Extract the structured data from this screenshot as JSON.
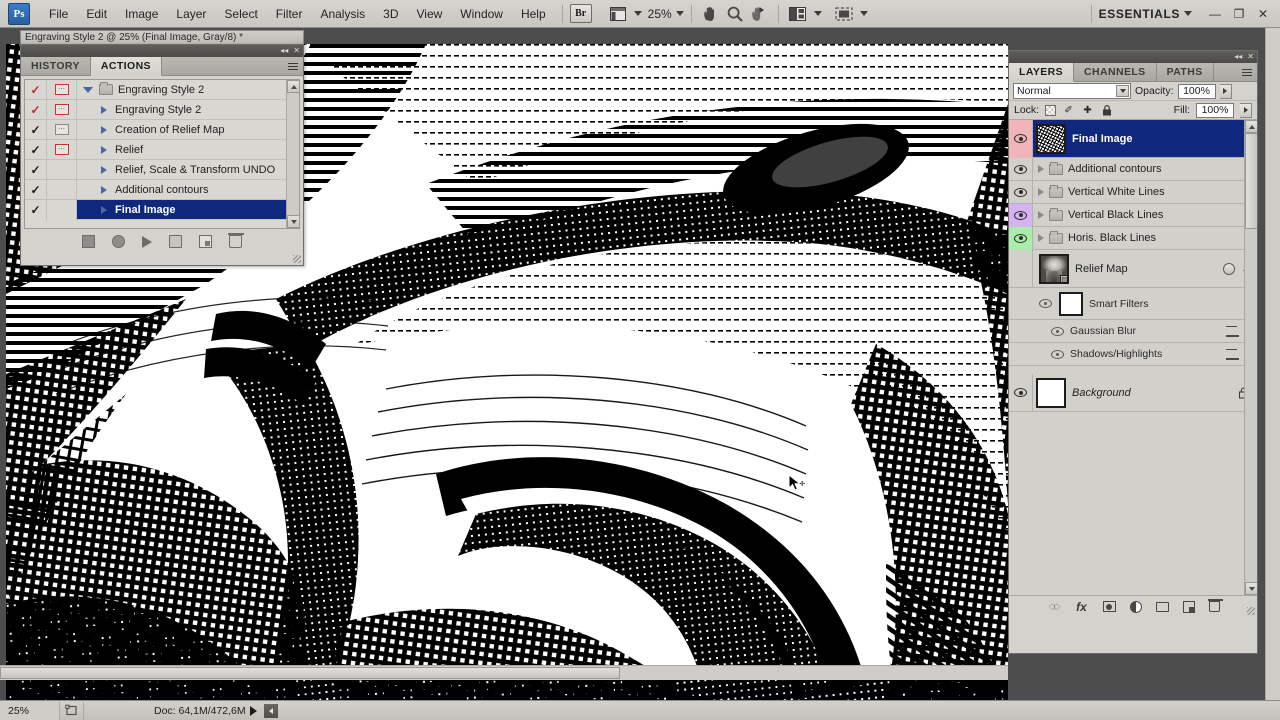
{
  "app": {
    "logo": "Ps",
    "workspace": "ESSENTIALS",
    "zoom_level": "25%"
  },
  "menubar": {
    "items": [
      {
        "label": "File"
      },
      {
        "label": "Edit"
      },
      {
        "label": "Image"
      },
      {
        "label": "Layer"
      },
      {
        "label": "Select"
      },
      {
        "label": "Filter"
      },
      {
        "label": "Analysis"
      },
      {
        "label": "3D"
      },
      {
        "label": "View"
      },
      {
        "label": "Window"
      },
      {
        "label": "Help"
      }
    ],
    "bridge_button": "Br",
    "view_extras_icon": "screen-mode-icon",
    "zoom_value": "25%",
    "hand_tool_icon": "hand-icon",
    "zoom_tool_icon": "magnifier-icon",
    "rotate_view_icon": "rotate-view-icon",
    "arrange_docs_icon": "arrange-documents-icon",
    "screen_mode_icon": "screen-mode-icon",
    "minimize_icon": "—",
    "maximize_icon": "❐",
    "close_icon": "✕"
  },
  "document": {
    "tab_title": "Engraving Style 2 @ 25% (Final Image, Gray/8) *"
  },
  "actions_panel": {
    "tabs": [
      {
        "label": "HISTORY",
        "active": false
      },
      {
        "label": "ACTIONS",
        "active": true
      }
    ],
    "rows": [
      {
        "label": "Engraving Style 2",
        "check": "red",
        "modal": "red",
        "type": "set",
        "expanded": true,
        "selected": false
      },
      {
        "label": "Engraving Style 2",
        "check": "red",
        "modal": "red",
        "type": "action",
        "expanded": false,
        "selected": false
      },
      {
        "label": "Creation of Relief Map",
        "check": "black",
        "modal": "gray",
        "type": "action",
        "expanded": false,
        "selected": false
      },
      {
        "label": "Relief",
        "check": "black",
        "modal": "red",
        "type": "action",
        "expanded": false,
        "selected": false
      },
      {
        "label": "Relief, Scale & Transform UNDO",
        "check": "black",
        "modal": "none",
        "type": "action",
        "expanded": false,
        "selected": false
      },
      {
        "label": "Additional contours",
        "check": "black",
        "modal": "none",
        "type": "action",
        "expanded": false,
        "selected": false
      },
      {
        "label": "Final Image",
        "check": "black",
        "modal": "none",
        "type": "action",
        "expanded": false,
        "selected": true
      }
    ],
    "footer_icons": [
      {
        "name": "stop-playing-recording-button"
      },
      {
        "name": "begin-recording-button"
      },
      {
        "name": "play-selection-button"
      },
      {
        "name": "create-new-set-button"
      },
      {
        "name": "create-new-action-button"
      },
      {
        "name": "delete-button"
      }
    ]
  },
  "layers_panel": {
    "tabs": [
      {
        "label": "LAYERS",
        "active": true
      },
      {
        "label": "CHANNELS",
        "active": false
      },
      {
        "label": "PATHS",
        "active": false
      }
    ],
    "blend_mode": "Normal",
    "opacity_label": "Opacity:",
    "opacity_value": "100%",
    "lock_label": "Lock:",
    "fill_label": "Fill:",
    "fill_value": "100%",
    "lock_icons": [
      {
        "name": "lock-transparent-pixels-icon"
      },
      {
        "name": "lock-image-pixels-icon",
        "glyph": "✐"
      },
      {
        "name": "lock-position-icon",
        "glyph": "✢"
      },
      {
        "name": "lock-all-icon",
        "glyph": "ὑ2"
      }
    ],
    "layers": [
      {
        "name": "Final Image",
        "kind": "layer",
        "thumb": "hatch",
        "eye_color": "pink",
        "selected": true,
        "has_expand": false
      },
      {
        "name": "Additional contours",
        "kind": "group",
        "thumb": "folder",
        "eye_color": "none",
        "selected": false,
        "has_expand": true
      },
      {
        "name": "Vertical White Lines",
        "kind": "group",
        "thumb": "folder",
        "eye_color": "none",
        "selected": false,
        "has_expand": true
      },
      {
        "name": "Vertical Black Lines",
        "kind": "group",
        "thumb": "folder",
        "eye_color": "purple",
        "selected": false,
        "has_expand": true
      },
      {
        "name": "Horis. Black Lines",
        "kind": "group",
        "thumb": "folder",
        "eye_color": "green",
        "selected": false,
        "has_expand": true
      },
      {
        "name": "Relief Map",
        "kind": "smart",
        "thumb": "portrait",
        "eye_color": "off",
        "selected": false,
        "has_expand": false
      }
    ],
    "smart_filters": {
      "title": "Smart Filters",
      "items": [
        {
          "label": "Gaussian Blur"
        },
        {
          "label": "Shadows/Highlights"
        }
      ]
    },
    "background_layer": {
      "name": "Background",
      "locked": true
    },
    "footer_icons": [
      {
        "name": "link-layers-button"
      },
      {
        "name": "layer-style-button",
        "glyph": "fx"
      },
      {
        "name": "add-layer-mask-button"
      },
      {
        "name": "new-adjustment-layer-button"
      },
      {
        "name": "new-group-button"
      },
      {
        "name": "new-layer-button"
      },
      {
        "name": "delete-layer-button"
      }
    ]
  },
  "statusbar": {
    "zoom_value": "25%",
    "doc_info": "Doc: 64,1M/472,6M",
    "preview_icon": "preview-thumbnail-icon"
  },
  "colors": {
    "selection_blue": "#10277e",
    "panel_bg": "#d4d2cd",
    "chrome": "#c9c7c2",
    "eye_pink": "#f0b4ba",
    "eye_purple": "#d6b3f0",
    "eye_green": "#a9eda9",
    "check_red": "#c22a2a",
    "canvas_bg": "#4d4d4d"
  }
}
